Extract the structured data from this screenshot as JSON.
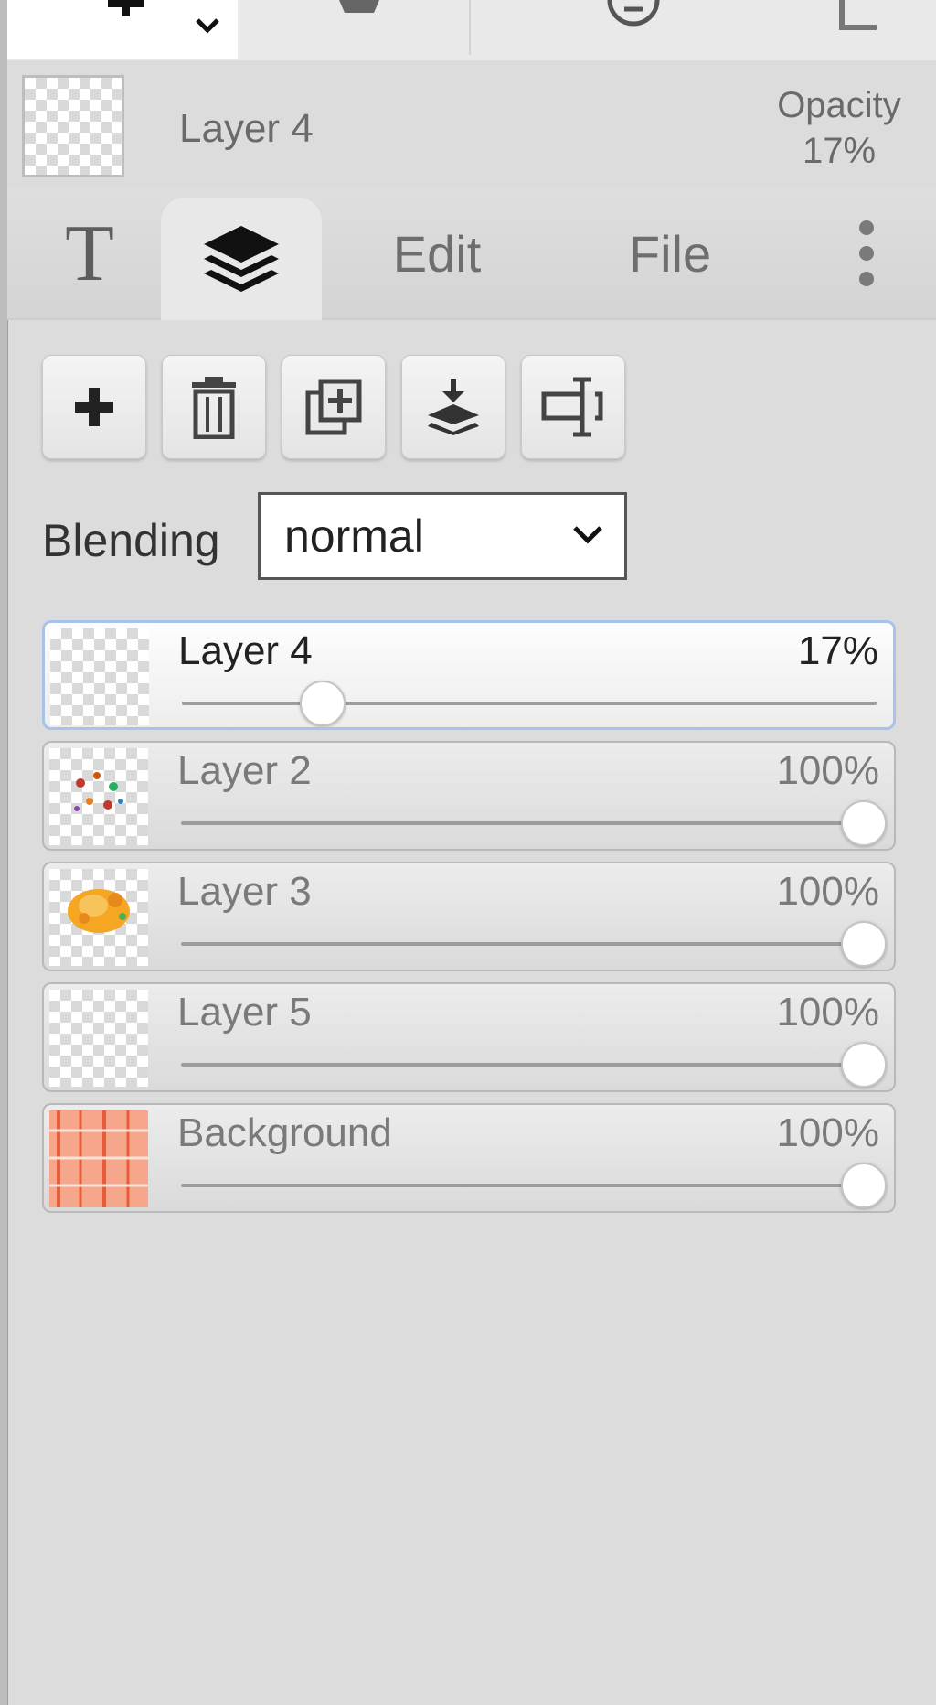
{
  "header": {
    "layer_name": "Layer 4",
    "opacity_label": "Opacity",
    "opacity_value": "17%"
  },
  "tabs": [
    {
      "label": "T",
      "icon": "text-tool-icon"
    },
    {
      "label": "",
      "icon": "layers-icon",
      "active": true
    },
    {
      "label": "Edit"
    },
    {
      "label": "File"
    },
    {
      "label": "",
      "icon": "more-vertical-icon"
    }
  ],
  "actions": [
    {
      "icon": "plus-icon"
    },
    {
      "icon": "trash-icon"
    },
    {
      "icon": "duplicate-layer-icon"
    },
    {
      "icon": "merge-down-icon"
    },
    {
      "icon": "rename-layer-icon"
    }
  ],
  "blending": {
    "label": "Blending",
    "selected": "normal"
  },
  "layers": [
    {
      "name": "Layer 4",
      "opacity": "17%",
      "value": 17,
      "active": true
    },
    {
      "name": "Layer 2",
      "opacity": "100%",
      "value": 100
    },
    {
      "name": "Layer 3",
      "opacity": "100%",
      "value": 100
    },
    {
      "name": "Layer 5",
      "opacity": "100%",
      "value": 100
    },
    {
      "name": "Background",
      "opacity": "100%",
      "value": 100
    }
  ],
  "colors": {
    "panel_bg": "#dcdcdc",
    "active_row_border": "#a9c2ec",
    "background_thumb": "#f7b39a"
  }
}
